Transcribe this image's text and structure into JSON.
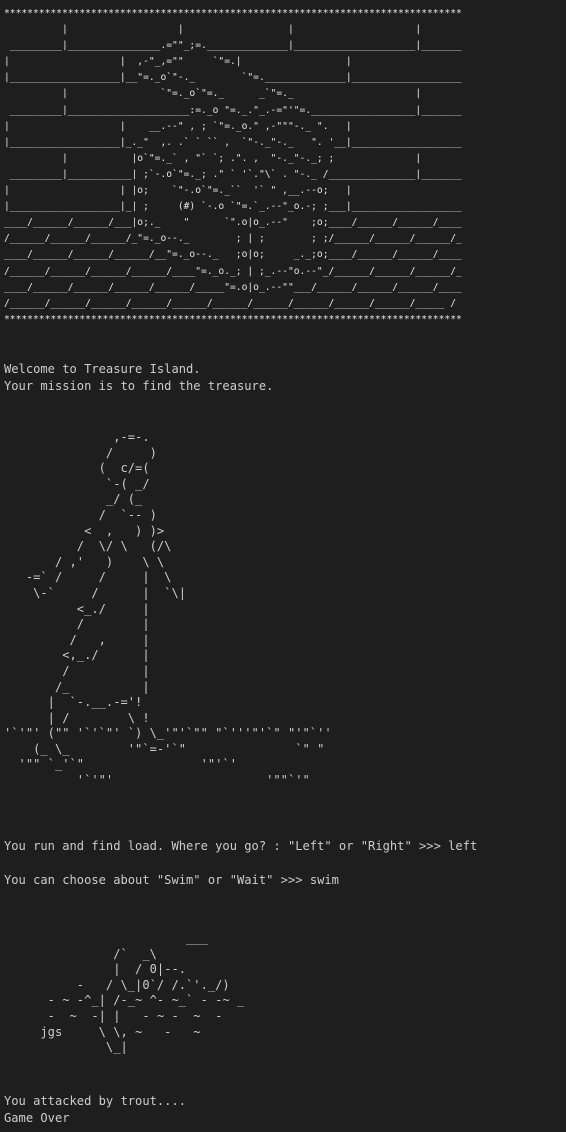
{
  "banner": {
    "ascii": "*******************************************************************************\n          |                   |                  |                     |\n _________|________________.=\"\"_;=.______________|_____________________|_______\n|                   |  ,-\"_,=\"\"     `\"=.|                  |\n|___________________|__\"=._o`\"-._        `\"=.______________|___________________\n          |                `\"=._o`\"=._      _`\"=._                     |\n _________|_____________________:=._o \"=._.\"_.-=\"'\"=.__________________|_______\n|                   |    __.--\" , ; `\"=._o.\" ,-\"\"\"-._ \".   |\n|___________________|_._\"  ,. .` ` `` ,  `\"-._\"-._   \". '__|___________________\n          |           |o`\"=._` , \"` `; .\". ,  \"-._\"-._; ;              |\n _________|___________| ;`-.o`\"=._; .\" ` '`.\"\\` . \"-._ /_______________|_______\n|                   | |o;    `\"-.o`\"=._``  '` \" ,__.--o;   |\n|___________________|_| ;     (#) `-.o `\"=.`_.--\"_o.-; ;___|___________________\n____/______/______/___|o;._    \"      `\".o|o_.--\"    ;o;____/______/______/____\n/______/______/______/_\"=._o--._        ; | ;        ; ;/______/______/______/_\n____/______/______/______/__\"=._o--._   ;o|o;     _._;o;____/______/______/____\n/______/______/______/______/____\"=._o._; | ;_.--\"o.--\"_/______/______/______/_\n____/______/______/______/______/_____\"=.o|o_.--\"\"___/______/______/______/____\n/______/______/______/______/______/______/______/______/______/______/_____ /\n*******************************************************************************"
  },
  "intro": {
    "welcome": "Welcome to Treasure Island.",
    "mission": "Your mission is to find the treasure."
  },
  "walker": {
    "ascii": "               ,-=-.\n              /     )\n             (  c/=(\n              `-( _/\n              _/ (_\n             /  `-- )\n           <  ,   ) )>\n          /  \\/ \\   (/\\\n       / ,'   )    \\ \\\n   -=` /     /     |  \\\n    \\-`     /      |  `\\|\n          <_./     |\n          /        |\n         /   ,     |\n        <,_./      |\n        /          |\n       /_          |\n      |  `-.__.-='!\n      | /        \\ !\n'`'\"' (\"\" '`'`\"' `) \\_'\"'`\"\" \"`'''\"'`\" \"'\"`''\n    (_ \\_        '\"`=-'`\"               `\" \"\n  '\"\" `_'`\"                '\"'`'\n          '`'\"'                     '\"\"`'\""
  },
  "prompt1": {
    "text": "You run and find load. Where you go? : \"Left\" or \"Right\" >>> ",
    "input": "left"
  },
  "prompt2": {
    "text": "You can choose about \"Swim\" or \"Wait\" >>> ",
    "input": "swim"
  },
  "fish": {
    "ascii": "                         ___\n               /`  _\\\n               |  / 0|--.\n          -   / \\_|0`/ /.`'._/)\n      - ~ -^_| /-_~ ^- ~_` - -~ _\n      -  ~  -| |   - ~ -  ~  -\n     jgs     \\ \\, ~   -   ~\n              \\_|"
  },
  "ending": {
    "attack": "You attacked by trout....",
    "game_over": "Game Over"
  }
}
